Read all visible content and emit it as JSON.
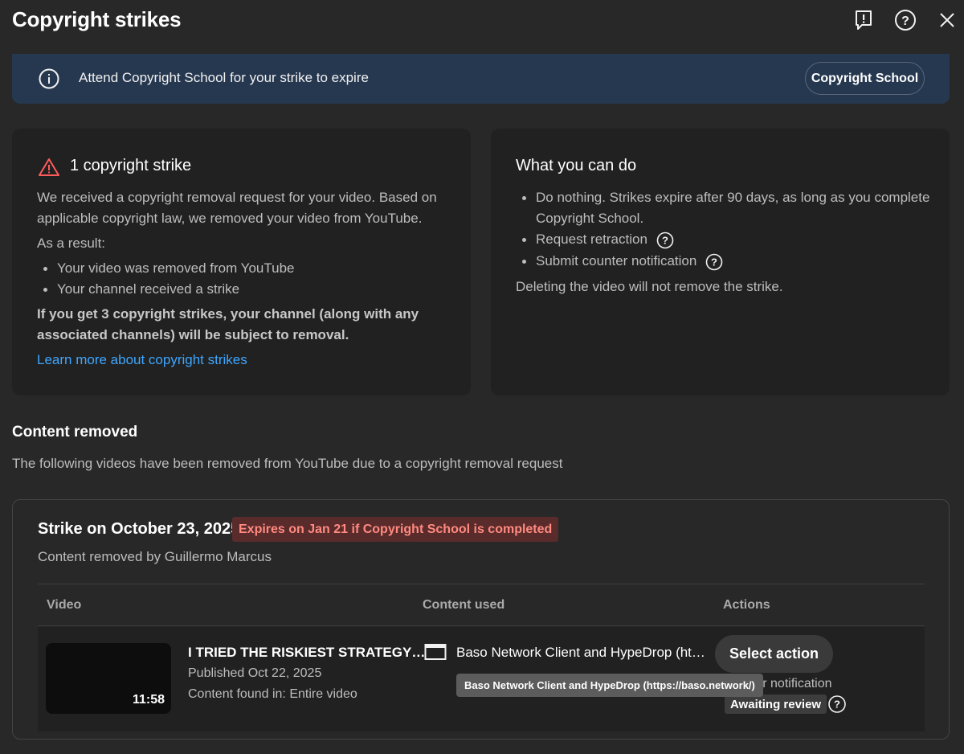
{
  "header": {
    "title": "Copyright strikes",
    "icons": [
      "feedback-icon",
      "help-icon",
      "close-icon"
    ]
  },
  "banner": {
    "text": "Attend Copyright School for your strike to expire",
    "button_label": "Copyright School"
  },
  "strike_card": {
    "heading": "1 copyright strike",
    "para1_line1": "We received a copyright removal request for your video. Based on",
    "para1_line2": "applicable copyright law, we removed your video from YouTube.",
    "as_result": "As a result:",
    "bullets": [
      "Your video was removed from YouTube",
      "Your channel received a strike"
    ],
    "warning_line1": "If you get 3 copyright strikes, your channel (along with any",
    "warning_line2": "associated channels) will be subject to removal.",
    "learn_more": "Learn more about copyright strikes"
  },
  "options_card": {
    "heading": "What you can do",
    "bullet1_line1": "Do nothing. Strikes expire after 90 days, as long as you complete",
    "bullet1_line2": "Copyright School.",
    "bullet2": "Request retraction",
    "bullet3": "Submit counter notification",
    "footer": "Deleting the video will not remove the strike."
  },
  "content_removed": {
    "title": "Content removed",
    "subtitle": "The following videos have been removed from YouTube due to a copyright removal request"
  },
  "strike": {
    "title": "Strike on October 23, 2025",
    "expiry": "Expires on Jan 21 if Copyright School is completed",
    "removed_by": "Content removed by Guillermo Marcus",
    "columns": [
      "Video",
      "Content used",
      "Actions"
    ],
    "row": {
      "duration": "11:58",
      "video_title": "I TRIED THE RISKIEST STRATEGY…",
      "published": "Published Oct 22, 2025",
      "found_in": "Content found in: Entire video",
      "content_used": "Baso Network Client and HypeDrop (ht…",
      "action_button": "Select action",
      "counter_fragment": "nter notification",
      "status": "Awaiting review"
    },
    "tooltip": "Baso Network Client and HypeDrop (https://baso.network/)"
  }
}
